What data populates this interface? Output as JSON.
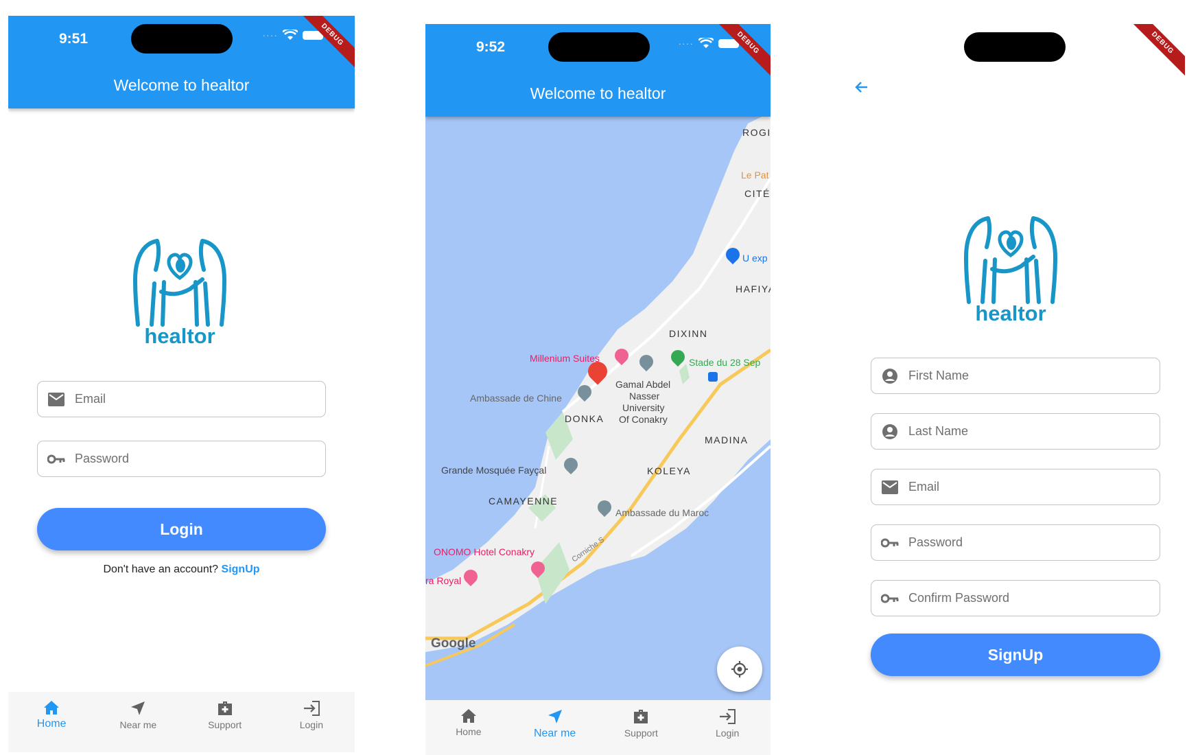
{
  "screens": {
    "login": {
      "status_time": "9:51",
      "title": "Welcome to healtor",
      "debug": "DEBUG",
      "logo_text": "healtor",
      "email_placeholder": "Email",
      "password_placeholder": "Password",
      "login_label": "Login",
      "no_account_text": "Don't have an account?",
      "signup_link": "SignUp"
    },
    "map": {
      "status_time": "9:52",
      "title": "Welcome to healtor",
      "debug": "DEBUG",
      "labels": {
        "rogi": "ROGI",
        "le_pat": "Le Pat",
        "cite": "CITÉ",
        "u_exp": "U exp",
        "hafiya": "HAFIYA",
        "dixinn": "DIXINN",
        "millenium": "Millenium Suites",
        "stade": "Stade du 28 Sep",
        "gamal": "Gamal Abdel",
        "nasser": "Nasser",
        "university": "University",
        "of_conakry": "Of Conakry",
        "ambassade_chine": "Ambassade de Chine",
        "donka": "DONKA",
        "madina": "MADINA",
        "grande_mosquee": "Grande Mosquée Fayçal",
        "koleya": "KOLEYA",
        "camayenne": "CAMAYENNE",
        "ambassade_maroc": "Ambassade du Maroc",
        "onomo": "ONOMO Hotel Conakry",
        "corniche": "Corniche S",
        "ra_royal": "ra Royal",
        "google": "Google"
      }
    },
    "signup": {
      "debug": "DEBUG",
      "logo_text": "healtor",
      "first_name_placeholder": "First Name",
      "last_name_placeholder": "Last Name",
      "email_placeholder": "Email",
      "password_placeholder": "Password",
      "confirm_password_placeholder": "Confirm Password",
      "signup_label": "SignUp"
    }
  },
  "nav": {
    "items": [
      "Home",
      "Near me",
      "Support",
      "Login"
    ],
    "icons": [
      "home-icon",
      "navigation-icon",
      "medical-kit-icon",
      "login-icon"
    ]
  },
  "colors": {
    "appbar": "#2196f3",
    "button": "#448aff",
    "logo": "#1796c7",
    "nav_active": "#2196f3",
    "map_water": "#a6c6f7"
  }
}
